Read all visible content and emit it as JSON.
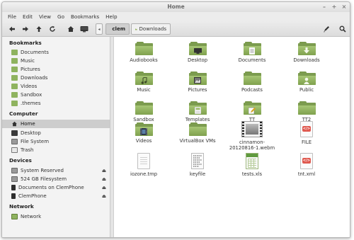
{
  "window": {
    "title": "Home",
    "controls": [
      "–",
      "+",
      "×"
    ]
  },
  "menu": [
    "File",
    "Edit",
    "View",
    "Go",
    "Bookmarks",
    "Help"
  ],
  "toolbar": {
    "back": "back-arrow",
    "forward": "forward-arrow",
    "up": "up-arrow",
    "reload": "reload",
    "home": "home",
    "computer": "computer",
    "toggle": "◂",
    "breadcrumbs": [
      {
        "label": "clem",
        "icon": "home",
        "active": true
      },
      {
        "label": "Downloads",
        "icon": "folder",
        "active": false
      }
    ]
  },
  "sidebar": {
    "bookmarks_title": "Bookmarks",
    "bookmarks": [
      "Documents",
      "Music",
      "Pictures",
      "Downloads",
      "Videos",
      "Sandbox",
      ".themes"
    ],
    "computer_title": "Computer",
    "computer": [
      "Home",
      "Desktop",
      "File System",
      "Trash"
    ],
    "computer_selected": "Home",
    "devices_title": "Devices",
    "devices": [
      "System Reserved",
      "524 GB Filesystem",
      "Documents on ClemPhone",
      "ClemPhone"
    ],
    "eject": "⏏",
    "network_title": "Network",
    "network": [
      "Network"
    ]
  },
  "files": [
    {
      "name": "Audiobooks",
      "type": "folder",
      "emblem": ""
    },
    {
      "name": "Desktop",
      "type": "folder",
      "emblem": "desktop"
    },
    {
      "name": "Documents",
      "type": "folder",
      "emblem": "document"
    },
    {
      "name": "Downloads",
      "type": "folder",
      "emblem": "download"
    },
    {
      "name": "Music",
      "type": "folder",
      "emblem": "music"
    },
    {
      "name": "Pictures",
      "type": "folder",
      "emblem": "pictures"
    },
    {
      "name": "Podcasts",
      "type": "folder",
      "emblem": ""
    },
    {
      "name": "Public",
      "type": "folder",
      "emblem": "user"
    },
    {
      "name": "Sandbox",
      "type": "folder",
      "emblem": ""
    },
    {
      "name": "Templates",
      "type": "folder",
      "emblem": "templates"
    },
    {
      "name": "TT",
      "type": "folder",
      "emblem": "pencil"
    },
    {
      "name": "TT2",
      "type": "folder",
      "emblem": ""
    },
    {
      "name": "Videos",
      "type": "folder",
      "emblem": "film"
    },
    {
      "name": "VirtualBox VMs",
      "type": "folder",
      "emblem": ""
    },
    {
      "name": "cinnamon-20120816-1.webm",
      "type": "video",
      "emblem": ""
    },
    {
      "name": "FILE",
      "type": "html",
      "emblem": "</>"
    },
    {
      "name": "iozone.tmp",
      "type": "text",
      "emblem": ""
    },
    {
      "name": "keyfile",
      "type": "keyfile",
      "emblem": ""
    },
    {
      "name": "tests.xls",
      "type": "spreadsheet",
      "emblem": ""
    },
    {
      "name": "tnt.xml",
      "type": "html",
      "emblem": "</>"
    }
  ],
  "colors": {
    "folder_green": "#8fb35f",
    "selection": "#cdcdcd",
    "markup_red": "#e05a50"
  }
}
